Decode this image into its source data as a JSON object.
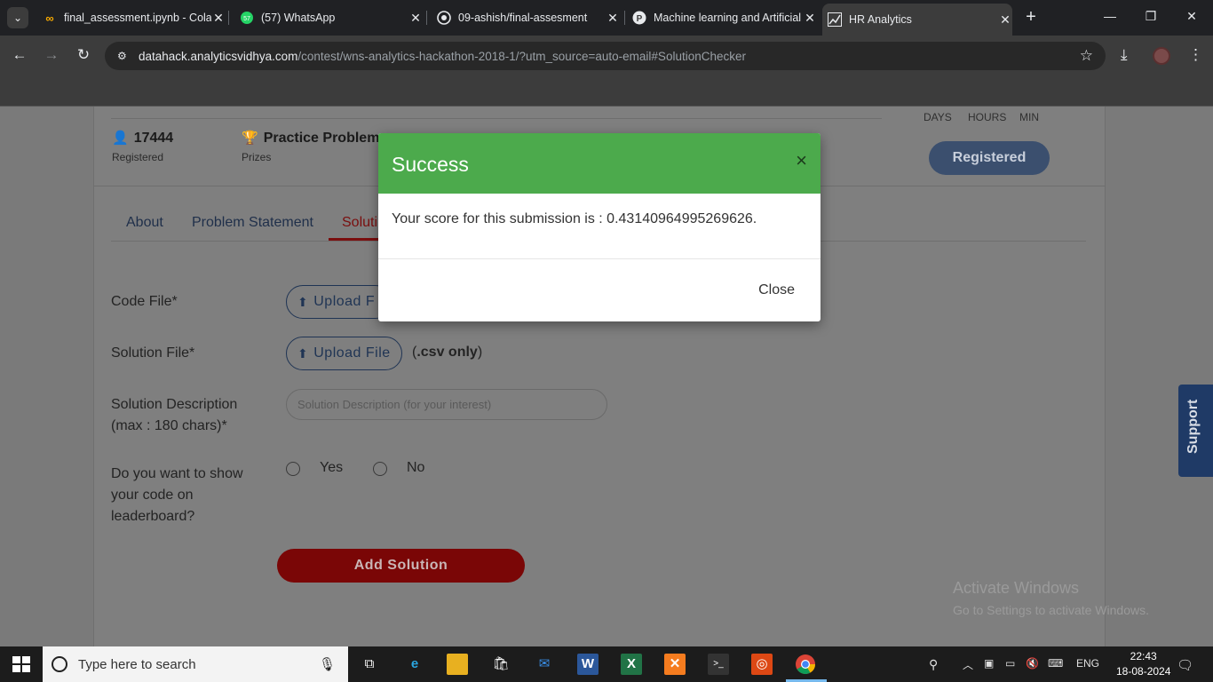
{
  "browser": {
    "tabs": [
      {
        "title": "final_assessment.ipynb - Colab",
        "icon": "colab-icon"
      },
      {
        "title": "(57) WhatsApp",
        "icon": "whatsapp-icon"
      },
      {
        "title": "09-ashish/final-assesment",
        "icon": "github-icon"
      },
      {
        "title": "Machine learning and Artificial",
        "icon": "perplexity-icon"
      },
      {
        "title": "HR Analytics",
        "icon": "analytics-icon",
        "active": true
      }
    ],
    "url_host": "datahack.analyticsvidhya.com",
    "url_path": "/contest/wns-analytics-hackathon-2018-1/?utm_source=auto-email#SolutionChecker"
  },
  "contest": {
    "registered_count": "17444",
    "registered_label": "Registered",
    "prizes_value": "Practice Problem",
    "prizes_label": "Prizes",
    "countdown_units": [
      "DAYS",
      "HOURS",
      "MIN"
    ],
    "register_button": "Registered"
  },
  "tabs": [
    "About",
    "Problem Statement",
    "Solution"
  ],
  "form": {
    "code_file_label": "Code File*",
    "solution_file_label": "Solution File*",
    "upload_label": "Upload File",
    "upload_label_partial": "Upload F",
    "csv_note_open": "(",
    "csv_note_bold": ".csv only",
    "csv_note_close": ")",
    "description_label_1": "Solution Description",
    "description_label_2": "(max : 180 chars)*",
    "description_placeholder": "Solution Description (for your interest)",
    "show_code_label_1": "Do you want to show",
    "show_code_label_2": "your code on",
    "show_code_label_3": "leaderboard?",
    "yes_label": "Yes",
    "no_label": "No",
    "submit_label": "Add Solution"
  },
  "support_label": "Support",
  "watermark": {
    "line1": "Activate Windows",
    "line2": "Go to Settings to activate Windows."
  },
  "modal": {
    "title": "Success",
    "close_x": "×",
    "message": "Your score for this submission is : 0.43140964995269626.",
    "close_button": "Close"
  },
  "taskbar": {
    "search_placeholder": "Type here to search",
    "language": "ENG",
    "time": "22:43",
    "date": "18-08-2024"
  },
  "colors": {
    "modal_header": "#4caa4c",
    "submit_button": "#7a0606",
    "register_button": "#3b4f6e",
    "support_tab": "#1f3a66"
  }
}
